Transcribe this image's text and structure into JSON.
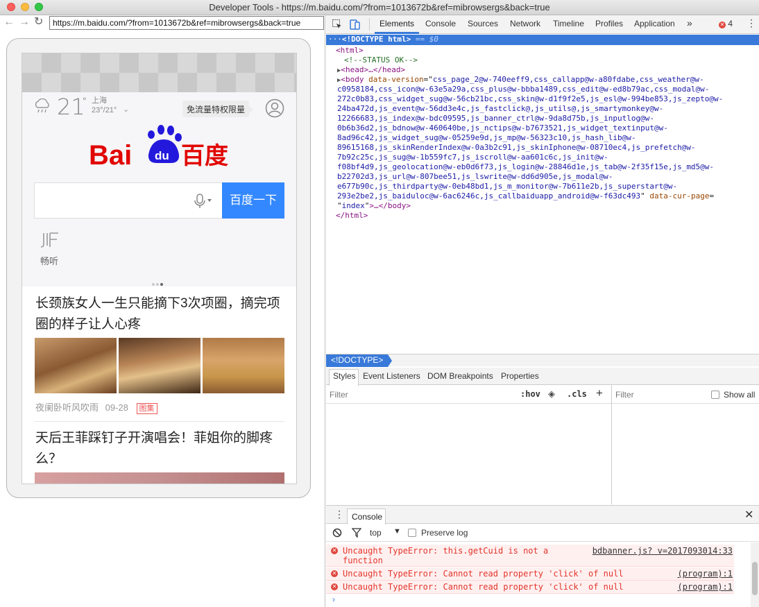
{
  "window": {
    "title": "Developer Tools - https://m.baidu.com/?from=1013672b&ref=mibrowsergs&back=true"
  },
  "browser": {
    "url": "https://m.baidu.com/?from=1013672b&ref=mibrowsergs&back=true"
  },
  "page": {
    "weather": {
      "temp": "21",
      "deg": "°",
      "city": "上海",
      "range": "23°/21°"
    },
    "promo_badge": "免流量特权限量",
    "search_button": "百度一下",
    "shortcut_label": "畅听",
    "news": [
      {
        "title": "长颈族女人一生只能摘下3次项圈，摘完项圈的样子让人心疼",
        "source": "夜阑卧听风吹雨",
        "date": "09-28",
        "tag": "图集"
      },
      {
        "title": "天后王菲踩钉子开演唱会！菲姐你的脚疼么？"
      }
    ]
  },
  "devtools": {
    "tabs": [
      "Elements",
      "Console",
      "Sources",
      "Network",
      "Timeline",
      "Profiles",
      "Application"
    ],
    "more": "»",
    "error_count": "4",
    "dom": {
      "selected": "<!DOCTYPE html>",
      "selected_suffix": "== $0",
      "html_open": "<html>",
      "comment": "<!--STATUS OK-->",
      "head": "<head>…</head>",
      "body_lines": [
        "css_page_2@w-740eeff9,css_callapp@w-a80fdabe,css_weather@w-",
        "c0958184,css_icon@w-63e5a29a,css_plus@w-bbba1489,css_edit@w-ed8b79ac,css_modal@w-",
        "272c0b83,css_widget_sug@w-56cb21bc,css_skin@w-d1f9f2e5,js_esl@w-994be853,js_zepto@w-",
        "24ba472d,js_event@w-56dd3e4c,js_fastclick@,js_utils@,js_smartymonkey@w-",
        "12266683,js_index@w-bdc09595,js_banner_ctrl@w-9da8d75b,js_inputlog@w-",
        "0b6b36d2,js_bdnow@w-460640be,js_nctips@w-b7673521,js_widget_textinput@w-",
        "8ad96c42,js_widget_sug@w-05259e9d,js_mp@w-56323c10,js_hash_lib@w-",
        "89615168,js_skinRenderIndex@w-0a3b2c91,js_skinIphone@w-08710ec4,js_prefetch@w-",
        "7b92c25c,js_sug@w-1b559fc7,js_iscroll@w-aa601c6c,js_init@w-",
        "f08bf4d9,js_geolocation@w-eb0d6f73,js_login@w-28846d1e,js_tab@w-2f35f15e,js_md5@w-",
        "b22702d3,js_url@w-807bee51,js_lswrite@w-dd6d905e,js_modal@w-",
        "e677b90c,js_thirdparty@w-0eb48bd1,js_m_monitor@w-7b611e2b,js_superstart@w-",
        "293e2be2,js_baiduloc@w-6ac6246c,js_callbaiduapp_android@w-f63dc493"
      ],
      "body_attr": "data-version",
      "body_attr2": "data-cur-page",
      "body_attr2_val": "index",
      "body_close": ">…</body>",
      "html_close": "</html>"
    },
    "breadcrumb": "<!DOCTYPE>",
    "styles_tabs": [
      "Styles",
      "Event Listeners",
      "DOM Breakpoints",
      "Properties"
    ],
    "filter_placeholder": "Filter",
    "hov": ":hov",
    "cls": ".cls",
    "filter2_placeholder": "Filter",
    "show_all": "Show all",
    "console_tab": "Console",
    "console_context": "top",
    "preserve_log": "Preserve log",
    "errors": [
      {
        "msg": "Uncaught TypeError: this.getCuid is not a function",
        "src": "bdbanner.js? v=2017093014:33"
      },
      {
        "msg": "Uncaught TypeError: Cannot read property 'click' of null",
        "src": "(program):1"
      },
      {
        "msg": "Uncaught TypeError: Cannot read property 'click' of null",
        "src": "(program):1"
      }
    ]
  },
  "colors": {
    "accent": "#3879d9",
    "search_blue": "#3388ff",
    "baidu_red": "#e10601",
    "baidu_blue": "#2319dc",
    "error_red": "#e3352a"
  }
}
